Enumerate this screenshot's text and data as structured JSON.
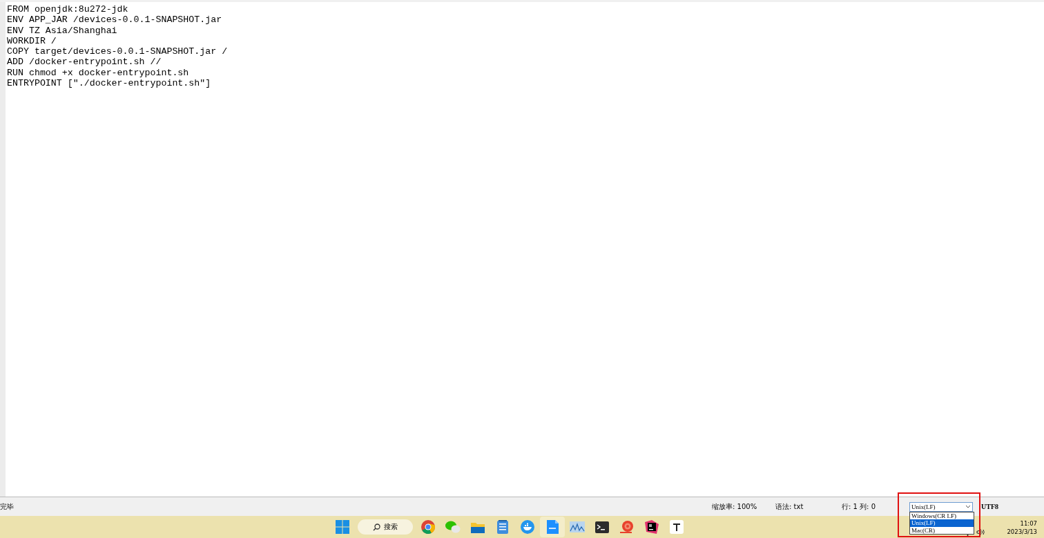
{
  "editor": {
    "lines": [
      "FROM openjdk:8u272-jdk",
      "ENV APP_JAR /devices-0.0.1-SNAPSHOT.jar",
      "ENV TZ Asia/Shanghai",
      "WORKDIR /",
      "COPY target/devices-0.0.1-SNAPSHOT.jar /",
      "ADD /docker-entrypoint.sh //",
      "RUN chmod +x docker-entrypoint.sh",
      "ENTRYPOINT [\"./docker-entrypoint.sh\"]"
    ]
  },
  "status_bar": {
    "message": "完毕",
    "zoom": "缩放率: 100%",
    "syntax": "语法: txt",
    "position": "行: 1 列: 0",
    "line_ending": {
      "value": "Unix(LF)",
      "expanded": true,
      "options": [
        {
          "label": "Windows(CR LF)",
          "selected": false
        },
        {
          "label": "Unix(LF)",
          "selected": true
        },
        {
          "label": "Mac(CR)",
          "selected": false
        }
      ]
    },
    "encoding": "UTF8"
  },
  "taskbar": {
    "search": "搜索",
    "apps": [
      {
        "kind": "chrome",
        "selected": false
      },
      {
        "kind": "wechat",
        "selected": false
      },
      {
        "kind": "folder",
        "selected": false
      },
      {
        "kind": "notepad",
        "selected": false
      },
      {
        "kind": "docker",
        "selected": false
      },
      {
        "kind": "txt",
        "selected": true
      },
      {
        "kind": "monitor",
        "selected": false
      },
      {
        "kind": "terminal",
        "selected": false
      },
      {
        "kind": "snail",
        "selected": false
      },
      {
        "kind": "jetbrains",
        "selected": false
      },
      {
        "kind": "font",
        "selected": false
      }
    ],
    "time": "11:07",
    "date": "2023/3/13"
  }
}
